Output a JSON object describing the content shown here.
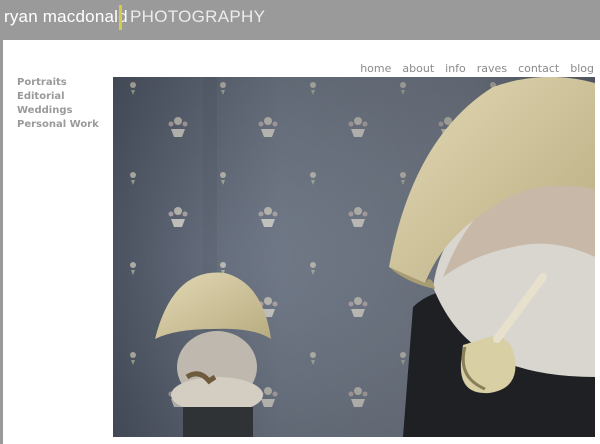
{
  "header": {
    "brand_name": "ryan macdonald",
    "brand_sub": "PHOTOGRAPHY",
    "accent_color": "#d3cc4a"
  },
  "topnav": {
    "items": [
      {
        "label": "home"
      },
      {
        "label": "about"
      },
      {
        "label": "info"
      },
      {
        "label": "raves"
      },
      {
        "label": "contact"
      },
      {
        "label": "blog"
      }
    ]
  },
  "sidenav": {
    "items": [
      {
        "label": "Portraits"
      },
      {
        "label": "Editorial"
      },
      {
        "label": "Weddings"
      },
      {
        "label": "Personal Work"
      }
    ]
  },
  "photo": {
    "subject": "photograph of a bearded man in a yellow sou'wester hat with a pipe beside a ceramic fisherman wall figure"
  },
  "colors": {
    "background": "#9a9a9a",
    "panel": "#ffffff",
    "nav_text": "#8a8a8a"
  }
}
